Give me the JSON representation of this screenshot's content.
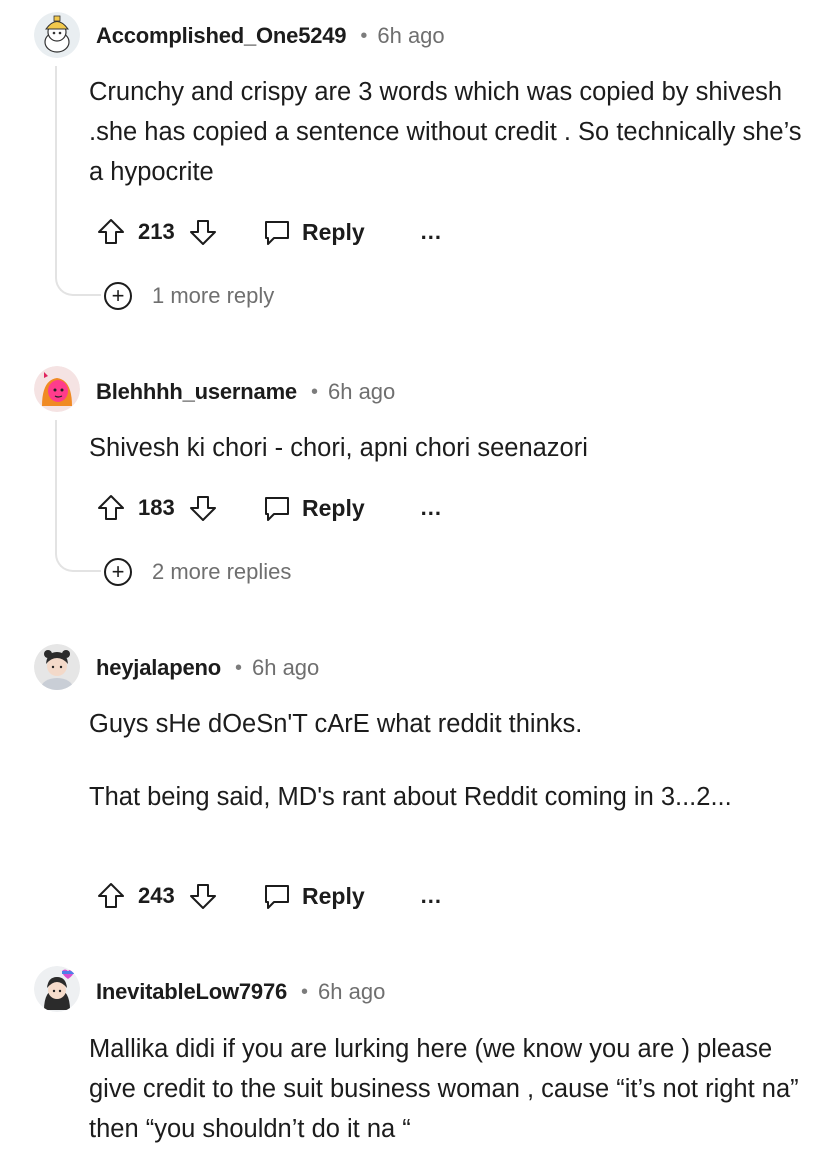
{
  "comments": [
    {
      "username": "Accomplished_One5249",
      "time": "6h ago",
      "paragraphs": [
        "Crunchy and crispy are 3 words which was copied by shivesh .she has copied a sentence without credit . So technically she’s a hypocrite"
      ],
      "score": "213",
      "reply_label": "Reply",
      "more_label": "...",
      "more_replies": "1 more reply"
    },
    {
      "username": "Blehhhh_username",
      "time": "6h ago",
      "paragraphs": [
        "Shivesh ki chori - chori, apni chori seenazori"
      ],
      "score": "183",
      "reply_label": "Reply",
      "more_label": "...",
      "more_replies": "2 more replies"
    },
    {
      "username": "heyjalapeno",
      "time": "6h ago",
      "paragraphs": [
        "Guys sHe dOeSn'T cArE what reddit thinks.",
        "That being said, MD's rant about Reddit coming in 3...2..."
      ],
      "score": "243",
      "reply_label": "Reply",
      "more_label": "..."
    },
    {
      "username": "InevitableLow7976",
      "time": "6h ago",
      "paragraphs": [
        "Mallika didi if you are lurking here (we know you are ) please give credit to the suit business woman , cause “it’s not right na” then “you shouldn’t do it na “"
      ]
    }
  ],
  "icons": {
    "upvote": "arrow-up-outline-icon",
    "downvote": "arrow-down-outline-icon",
    "reply": "chat-bubble-icon",
    "more": "ellipsis-icon",
    "expand": "plus-circle-icon"
  },
  "colors": {
    "text": "#1c1c1c",
    "meta": "#6f6f6f",
    "thread_line": "#e3e3e3"
  }
}
